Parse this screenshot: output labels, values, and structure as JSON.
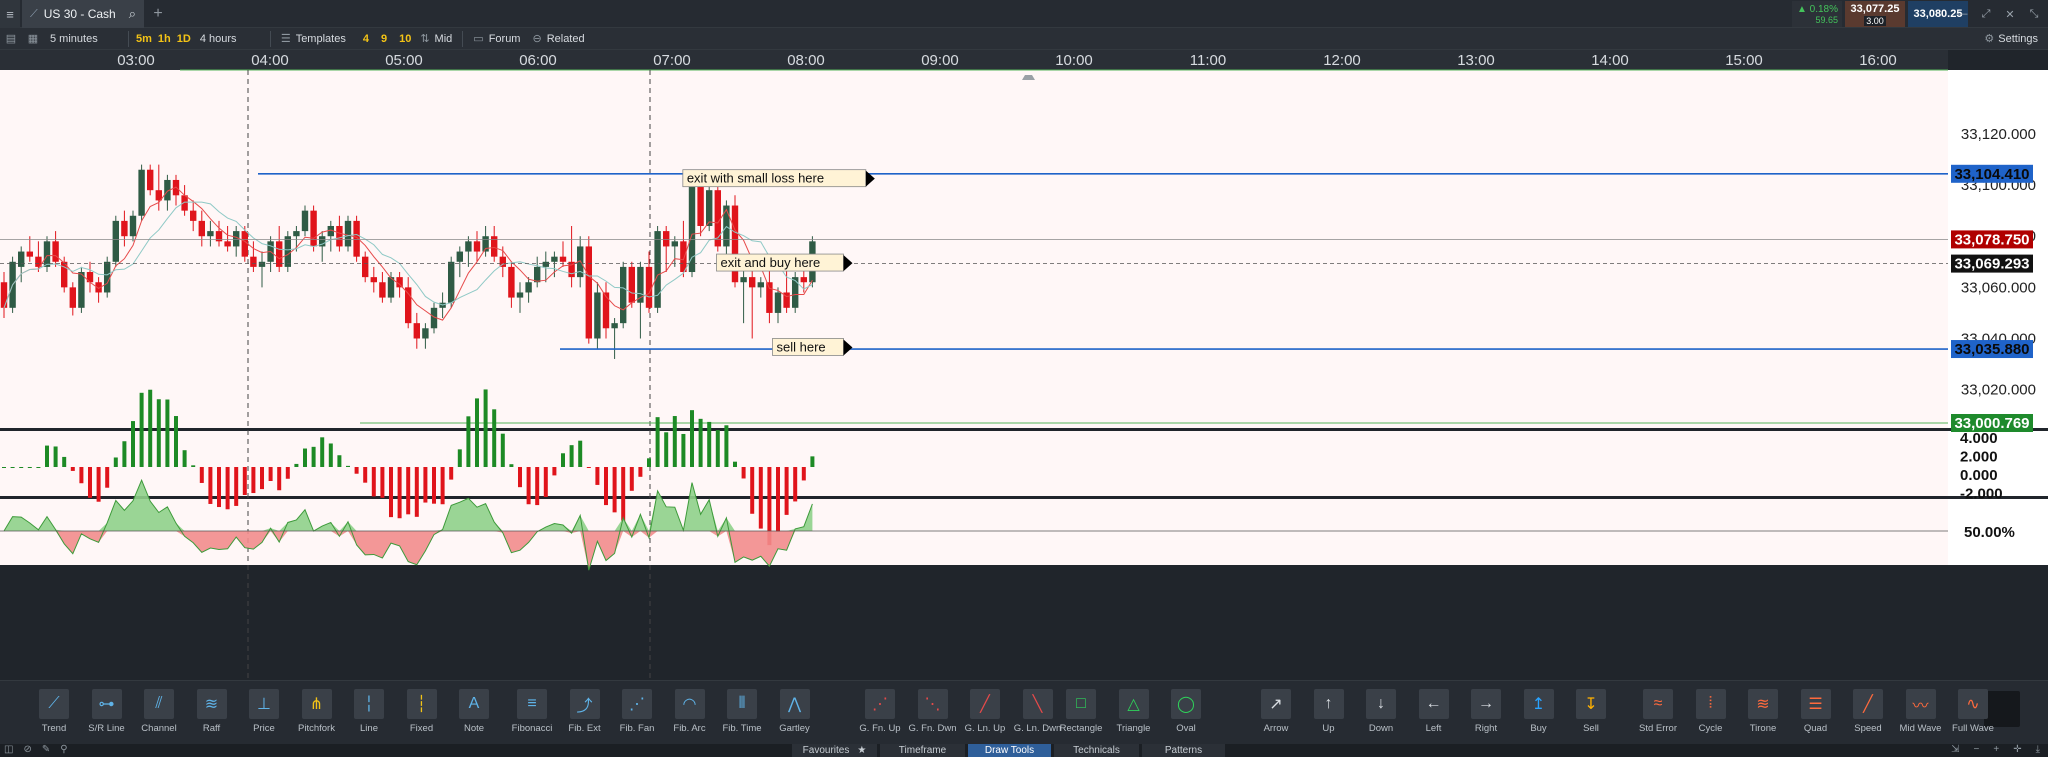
{
  "tab": {
    "title": "US 30 - Cash"
  },
  "quote": {
    "change_pct": "▲ 0.18%",
    "change_pts": "59.65",
    "bid": "33,077.25",
    "spread": "3.00",
    "ask": "33,080.25"
  },
  "toolbar": {
    "interval": "5 minutes",
    "quick_intervals": [
      "5m",
      "1h",
      "1D"
    ],
    "range": "4 hours",
    "templates": "Templates",
    "counts": [
      "4",
      "9",
      "10"
    ],
    "mid": "Mid",
    "forum": "Forum",
    "related": "Related",
    "settings": "Settings"
  },
  "colors": {
    "bull": "#2f5b45",
    "bear": "#e0141b",
    "hline": "#1f63c9",
    "last_price": "#b00000",
    "plot_bg": "#fff7f7"
  },
  "chart_data": {
    "type": "candlestick",
    "x_axis_labels": [
      "03:00",
      "04:00",
      "05:00",
      "06:00",
      "07:00",
      "08:00",
      "09:00",
      "10:00",
      "11:00",
      "12:00",
      "13:00",
      "14:00",
      "15:00",
      "16:00"
    ],
    "y_ticks": [
      "33,120.000",
      "33,100.000",
      "33,080.000",
      "33,060.000",
      "33,040.000",
      "33,020.000"
    ],
    "ylim": [
      33005,
      33145
    ],
    "price_tags": [
      {
        "label": "33,104.410",
        "value": 33104.41,
        "kind": "hline"
      },
      {
        "label": "33,078.750",
        "value": 33078.75,
        "kind": "last"
      },
      {
        "label": "33,069.293",
        "value": 33069.293,
        "kind": "dashed"
      },
      {
        "label": "33,035.880",
        "value": 33035.88,
        "kind": "hline"
      },
      {
        "label": "33,000.769",
        "value": 33000.769,
        "kind": "green"
      }
    ],
    "annotations": [
      {
        "text": "exit with small loss here",
        "time": "08:25",
        "value": 33102.5
      },
      {
        "text": "exit and buy here",
        "time": "08:15",
        "value": 33069.5
      },
      {
        "text": "sell here",
        "time": "08:15",
        "value": 33036.5
      }
    ],
    "candles": [
      {
        "o": 33062,
        "h": 33066,
        "l": 33048,
        "c": 33052
      },
      {
        "o": 33052,
        "h": 33072,
        "l": 33050,
        "c": 33070
      },
      {
        "o": 33068,
        "h": 33076,
        "l": 33062,
        "c": 33074
      },
      {
        "o": 33074,
        "h": 33080,
        "l": 33070,
        "c": 33072
      },
      {
        "o": 33072,
        "h": 33078,
        "l": 33066,
        "c": 33068
      },
      {
        "o": 33068,
        "h": 33080,
        "l": 33066,
        "c": 33078
      },
      {
        "o": 33078,
        "h": 33082,
        "l": 33068,
        "c": 33070
      },
      {
        "o": 33070,
        "h": 33072,
        "l": 33058,
        "c": 33060
      },
      {
        "o": 33060,
        "h": 33062,
        "l": 33049,
        "c": 33052
      },
      {
        "o": 33052,
        "h": 33068,
        "l": 33050,
        "c": 33066
      },
      {
        "o": 33066,
        "h": 33070,
        "l": 33058,
        "c": 33062
      },
      {
        "o": 33062,
        "h": 33064,
        "l": 33054,
        "c": 33058
      },
      {
        "o": 33058,
        "h": 33072,
        "l": 33056,
        "c": 33070
      },
      {
        "o": 33070,
        "h": 33088,
        "l": 33068,
        "c": 33086
      },
      {
        "o": 33086,
        "h": 33090,
        "l": 33076,
        "c": 33080
      },
      {
        "o": 33080,
        "h": 33090,
        "l": 33078,
        "c": 33088
      },
      {
        "o": 33088,
        "h": 33108,
        "l": 33086,
        "c": 33106
      },
      {
        "o": 33106,
        "h": 33108,
        "l": 33096,
        "c": 33098
      },
      {
        "o": 33098,
        "h": 33108,
        "l": 33090,
        "c": 33094
      },
      {
        "o": 33094,
        "h": 33104,
        "l": 33090,
        "c": 33102
      },
      {
        "o": 33102,
        "h": 33104,
        "l": 33092,
        "c": 33096
      },
      {
        "o": 33096,
        "h": 33100,
        "l": 33088,
        "c": 33090
      },
      {
        "o": 33090,
        "h": 33094,
        "l": 33082,
        "c": 33086
      },
      {
        "o": 33086,
        "h": 33090,
        "l": 33076,
        "c": 33080
      },
      {
        "o": 33080,
        "h": 33086,
        "l": 33076,
        "c": 33082
      },
      {
        "o": 33082,
        "h": 33086,
        "l": 33076,
        "c": 33078
      },
      {
        "o": 33078,
        "h": 33084,
        "l": 33074,
        "c": 33076
      },
      {
        "o": 33076,
        "h": 33084,
        "l": 33072,
        "c": 33082
      },
      {
        "o": 33082,
        "h": 33084,
        "l": 33070,
        "c": 33072
      },
      {
        "o": 33072,
        "h": 33078,
        "l": 33066,
        "c": 33068
      },
      {
        "o": 33068,
        "h": 33074,
        "l": 33060,
        "c": 33070
      },
      {
        "o": 33070,
        "h": 33080,
        "l": 33066,
        "c": 33078
      },
      {
        "o": 33078,
        "h": 33084,
        "l": 33066,
        "c": 33068
      },
      {
        "o": 33068,
        "h": 33082,
        "l": 33066,
        "c": 33080
      },
      {
        "o": 33080,
        "h": 33084,
        "l": 33074,
        "c": 33082
      },
      {
        "o": 33082,
        "h": 33092,
        "l": 33080,
        "c": 33090
      },
      {
        "o": 33090,
        "h": 33092,
        "l": 33074,
        "c": 33076
      },
      {
        "o": 33076,
        "h": 33082,
        "l": 33070,
        "c": 33080
      },
      {
        "o": 33080,
        "h": 33086,
        "l": 33074,
        "c": 33084
      },
      {
        "o": 33084,
        "h": 33088,
        "l": 33074,
        "c": 33076
      },
      {
        "o": 33076,
        "h": 33088,
        "l": 33074,
        "c": 33086
      },
      {
        "o": 33086,
        "h": 33088,
        "l": 33070,
        "c": 33072
      },
      {
        "o": 33072,
        "h": 33074,
        "l": 33062,
        "c": 33064
      },
      {
        "o": 33064,
        "h": 33068,
        "l": 33058,
        "c": 33062
      },
      {
        "o": 33062,
        "h": 33066,
        "l": 33054,
        "c": 33056
      },
      {
        "o": 33056,
        "h": 33066,
        "l": 33054,
        "c": 33064
      },
      {
        "o": 33064,
        "h": 33066,
        "l": 33056,
        "c": 33060
      },
      {
        "o": 33060,
        "h": 33064,
        "l": 33044,
        "c": 33046
      },
      {
        "o": 33046,
        "h": 33050,
        "l": 33036,
        "c": 33040
      },
      {
        "o": 33040,
        "h": 33046,
        "l": 33036,
        "c": 33044
      },
      {
        "o": 33044,
        "h": 33054,
        "l": 33042,
        "c": 33052
      },
      {
        "o": 33052,
        "h": 33058,
        "l": 33048,
        "c": 33054
      },
      {
        "o": 33054,
        "h": 33072,
        "l": 33052,
        "c": 33070
      },
      {
        "o": 33070,
        "h": 33076,
        "l": 33064,
        "c": 33074
      },
      {
        "o": 33074,
        "h": 33080,
        "l": 33068,
        "c": 33078
      },
      {
        "o": 33078,
        "h": 33082,
        "l": 33070,
        "c": 33074
      },
      {
        "o": 33074,
        "h": 33084,
        "l": 33072,
        "c": 33080
      },
      {
        "o": 33080,
        "h": 33084,
        "l": 33070,
        "c": 33072
      },
      {
        "o": 33072,
        "h": 33076,
        "l": 33064,
        "c": 33068
      },
      {
        "o": 33068,
        "h": 33070,
        "l": 33052,
        "c": 33056
      },
      {
        "o": 33056,
        "h": 33062,
        "l": 33050,
        "c": 33058
      },
      {
        "o": 33058,
        "h": 33064,
        "l": 33054,
        "c": 33062
      },
      {
        "o": 33062,
        "h": 33072,
        "l": 33060,
        "c": 33068
      },
      {
        "o": 33068,
        "h": 33074,
        "l": 33062,
        "c": 33070
      },
      {
        "o": 33070,
        "h": 33074,
        "l": 33064,
        "c": 33072
      },
      {
        "o": 33072,
        "h": 33078,
        "l": 33068,
        "c": 33070
      },
      {
        "o": 33070,
        "h": 33084,
        "l": 33060,
        "c": 33064
      },
      {
        "o": 33064,
        "h": 33080,
        "l": 33060,
        "c": 33076
      },
      {
        "o": 33076,
        "h": 33080,
        "l": 33038,
        "c": 33040
      },
      {
        "o": 33040,
        "h": 33062,
        "l": 33036,
        "c": 33058
      },
      {
        "o": 33058,
        "h": 33062,
        "l": 33040,
        "c": 33044
      },
      {
        "o": 33044,
        "h": 33048,
        "l": 33032,
        "c": 33046
      },
      {
        "o": 33046,
        "h": 33070,
        "l": 33044,
        "c": 33068
      },
      {
        "o": 33068,
        "h": 33070,
        "l": 33052,
        "c": 33054
      },
      {
        "o": 33054,
        "h": 33070,
        "l": 33040,
        "c": 33068
      },
      {
        "o": 33068,
        "h": 33074,
        "l": 33050,
        "c": 33052
      },
      {
        "o": 33052,
        "h": 33084,
        "l": 33050,
        "c": 33082
      },
      {
        "o": 33082,
        "h": 33084,
        "l": 33066,
        "c": 33076
      },
      {
        "o": 33076,
        "h": 33080,
        "l": 33068,
        "c": 33078
      },
      {
        "o": 33078,
        "h": 33086,
        "l": 33064,
        "c": 33066
      },
      {
        "o": 33066,
        "h": 33104,
        "l": 33064,
        "c": 33102
      },
      {
        "o": 33102,
        "h": 33104,
        "l": 33080,
        "c": 33084
      },
      {
        "o": 33084,
        "h": 33100,
        "l": 33082,
        "c": 33098
      },
      {
        "o": 33098,
        "h": 33100,
        "l": 33074,
        "c": 33076
      },
      {
        "o": 33076,
        "h": 33094,
        "l": 33072,
        "c": 33092
      },
      {
        "o": 33092,
        "h": 33096,
        "l": 33060,
        "c": 33062
      },
      {
        "o": 33062,
        "h": 33070,
        "l": 33046,
        "c": 33064
      },
      {
        "o": 33064,
        "h": 33068,
        "l": 33040,
        "c": 33060
      },
      {
        "o": 33060,
        "h": 33064,
        "l": 33056,
        "c": 33062
      },
      {
        "o": 33062,
        "h": 33068,
        "l": 33046,
        "c": 33050
      },
      {
        "o": 33050,
        "h": 33060,
        "l": 33046,
        "c": 33058
      },
      {
        "o": 33058,
        "h": 33072,
        "l": 33050,
        "c": 33052
      },
      {
        "o": 33052,
        "h": 33066,
        "l": 33050,
        "c": 33064
      },
      {
        "o": 33064,
        "h": 33068,
        "l": 33058,
        "c": 33062
      },
      {
        "o": 33062,
        "h": 33080,
        "l": 33060,
        "c": 33078
      }
    ],
    "macd_ticks": [
      "4.000",
      "2.000",
      "0.000",
      "-2.000"
    ],
    "rsi_label": "50.00%"
  },
  "tools": [
    {
      "label": "Trend",
      "icon": "trend-icon"
    },
    {
      "label": "S/R Line",
      "icon": "sr-line-icon"
    },
    {
      "label": "Channel",
      "icon": "channel-icon"
    },
    {
      "label": "Raff",
      "icon": "raff-icon"
    },
    {
      "label": "Price",
      "icon": "price-icon"
    },
    {
      "label": "Pitchfork",
      "icon": "pitchfork-icon"
    },
    {
      "label": "Line",
      "icon": "line-icon"
    },
    {
      "label": "Fixed",
      "icon": "fixed-icon"
    },
    {
      "label": "Note",
      "icon": "note-icon"
    },
    {
      "label": "Fibonacci",
      "icon": "fibonacci-icon"
    },
    {
      "label": "Fib. Ext",
      "icon": "fib-ext-icon"
    },
    {
      "label": "Fib. Fan",
      "icon": "fib-fan-icon"
    },
    {
      "label": "Fib. Arc",
      "icon": "fib-arc-icon"
    },
    {
      "label": "Fib. Time",
      "icon": "fib-time-icon"
    },
    {
      "label": "Gartley",
      "icon": "gartley-icon"
    },
    {
      "label": "G. Fn. Up",
      "icon": "gann-fan-up-icon"
    },
    {
      "label": "G. Fn. Dwn",
      "icon": "gann-fan-down-icon"
    },
    {
      "label": "G. Ln. Up",
      "icon": "gann-line-up-icon"
    },
    {
      "label": "G. Ln. Dwn",
      "icon": "gann-line-down-icon"
    },
    {
      "label": "Rectangle",
      "icon": "rectangle-icon"
    },
    {
      "label": "Triangle",
      "icon": "triangle-icon"
    },
    {
      "label": "Oval",
      "icon": "oval-icon"
    },
    {
      "label": "Arrow",
      "icon": "arrow-icon"
    },
    {
      "label": "Up",
      "icon": "arrow-up-icon"
    },
    {
      "label": "Down",
      "icon": "arrow-down-icon"
    },
    {
      "label": "Left",
      "icon": "arrow-left-icon"
    },
    {
      "label": "Right",
      "icon": "arrow-right-icon"
    },
    {
      "label": "Buy",
      "icon": "buy-icon"
    },
    {
      "label": "Sell",
      "icon": "sell-icon"
    },
    {
      "label": "Std Error",
      "icon": "std-error-icon"
    },
    {
      "label": "Cycle",
      "icon": "cycle-icon"
    },
    {
      "label": "Tirone",
      "icon": "tirone-icon"
    },
    {
      "label": "Quad",
      "icon": "quad-icon"
    },
    {
      "label": "Speed",
      "icon": "speed-icon"
    },
    {
      "label": "Mid Wave",
      "icon": "mid-wave-icon"
    },
    {
      "label": "Full Wave",
      "icon": "full-wave-icon"
    }
  ],
  "bottom_tabs": {
    "favourites": "Favourites",
    "timeframe": "Timeframe",
    "draw_tools": "Draw Tools",
    "technicals": "Technicals",
    "patterns": "Patterns"
  }
}
